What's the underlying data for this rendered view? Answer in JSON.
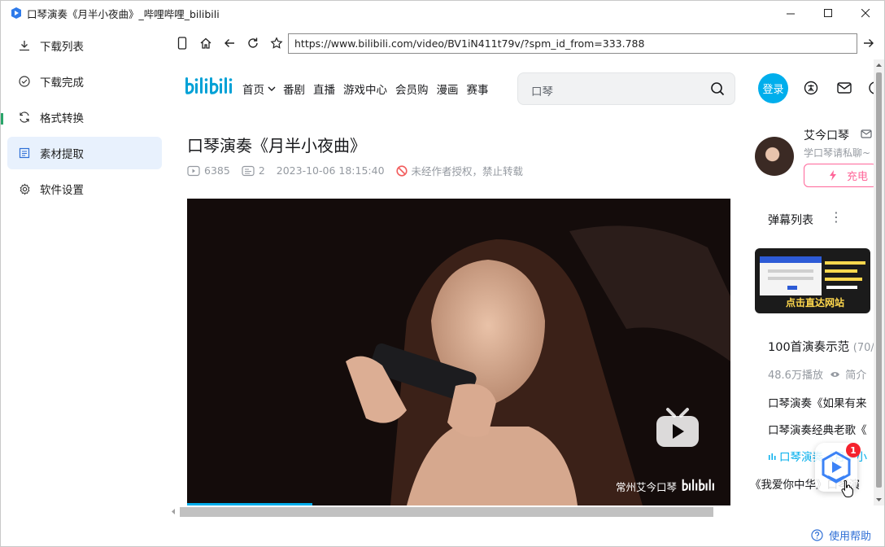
{
  "window": {
    "title": "口琴演奏《月半小夜曲》_哔哩哔哩_bilibili"
  },
  "sidebar": {
    "items": [
      {
        "label": "下载列表",
        "icon": "download-icon",
        "active": false
      },
      {
        "label": "下载完成",
        "icon": "check-circle-icon",
        "active": false
      },
      {
        "label": "格式转换",
        "icon": "convert-icon",
        "active": false
      },
      {
        "label": "素材提取",
        "icon": "extract-icon",
        "active": true
      },
      {
        "label": "软件设置",
        "icon": "gear-icon",
        "active": false
      }
    ],
    "help_label": "使用帮助"
  },
  "browser": {
    "url": "https://www.bilibili.com/video/BV1iN411t79v/?spm_id_from=333.788"
  },
  "site": {
    "nav": [
      "首页",
      "番剧",
      "直播",
      "游戏中心",
      "会员购",
      "漫画",
      "赛事"
    ],
    "search_query": "口琴",
    "login_label": "登录"
  },
  "video": {
    "title": "口琴演奏《月半小夜曲》",
    "views": "6385",
    "danmaku": "2",
    "date": "2023-10-06 18:15:40",
    "copyright": "未经作者授权，禁止转载",
    "watermark": "常州艾今口琴",
    "progress": 0.23
  },
  "uploader": {
    "name": "艾今口琴",
    "desc": "学口琴请私聊~",
    "charge_label": "充电"
  },
  "danmu_list_label": "弹幕列表",
  "ad": {
    "text": "点击直达网站"
  },
  "playlist": {
    "title": "100首演奏示范",
    "count": "(70/",
    "plays": "48.6万播放",
    "intro": "简介",
    "items": [
      {
        "title": "口琴演奏《如果有来",
        "current": false
      },
      {
        "title": "口琴演奏经典老歌《",
        "current": false
      },
      {
        "title": "口琴演奏《月半小",
        "current": true
      },
      {
        "title": "《我爱你中华》口琴演",
        "current": false
      }
    ]
  },
  "float_badge": "1",
  "colors": {
    "accent": "#00aeec",
    "active_bg": "#e8f1fd",
    "charge": "#ff6699",
    "link": "#2f6fd6"
  }
}
